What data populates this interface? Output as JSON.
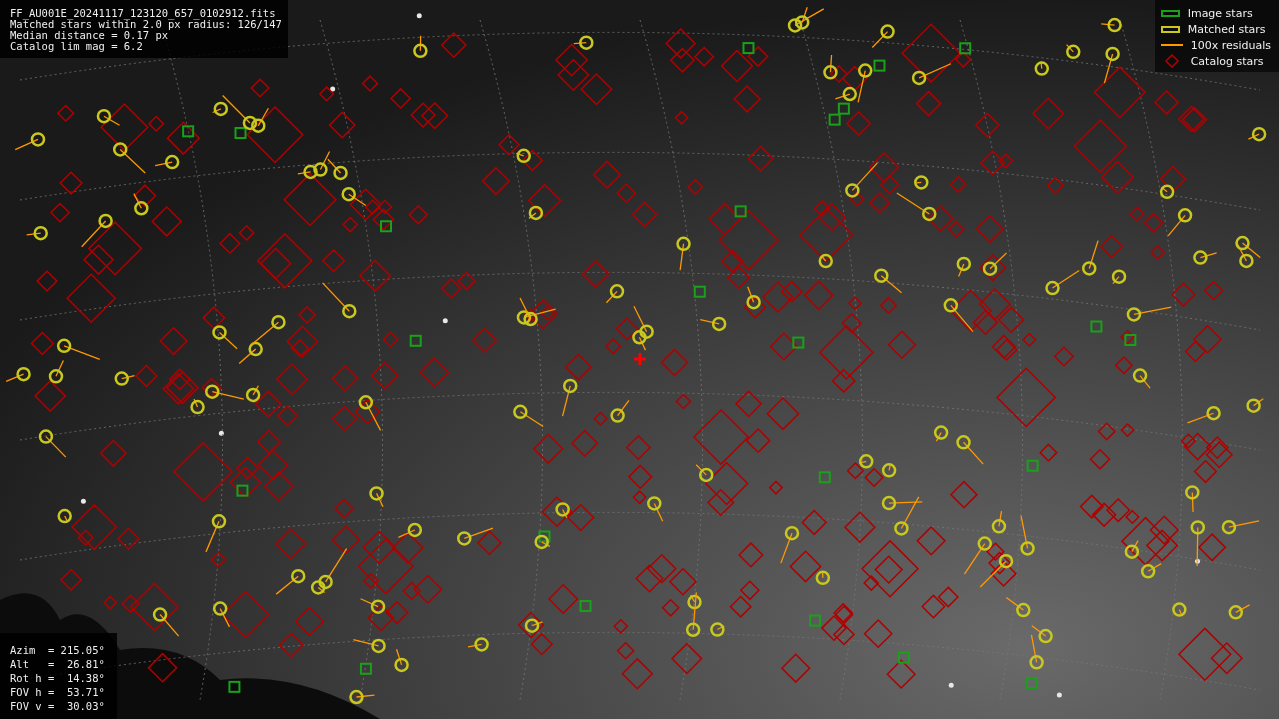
{
  "header": {
    "lines": [
      "FF_AU001E_20241117_123120_657_0102912.fits",
      "Matched stars within 2.0 px radius: 126/147",
      "Median distance = 0.17 px",
      "Catalog lim mag = 6.2"
    ]
  },
  "legend": [
    {
      "label": "Image stars",
      "kind": "box",
      "color": "#1aa01a"
    },
    {
      "label": "Matched stars",
      "kind": "box",
      "color": "#c8c81e"
    },
    {
      "label": "100x residuals",
      "kind": "line",
      "color": "#ff9900"
    },
    {
      "label": "Catalog stars",
      "kind": "none",
      "color": "#b00000"
    }
  ],
  "pointing": {
    "lines": [
      "Azim  = 215.05°",
      "Alt   =  26.81°",
      "Rot h =  14.38°",
      "FOV h =  53.71°",
      "FOV v =  30.03°"
    ]
  }
}
